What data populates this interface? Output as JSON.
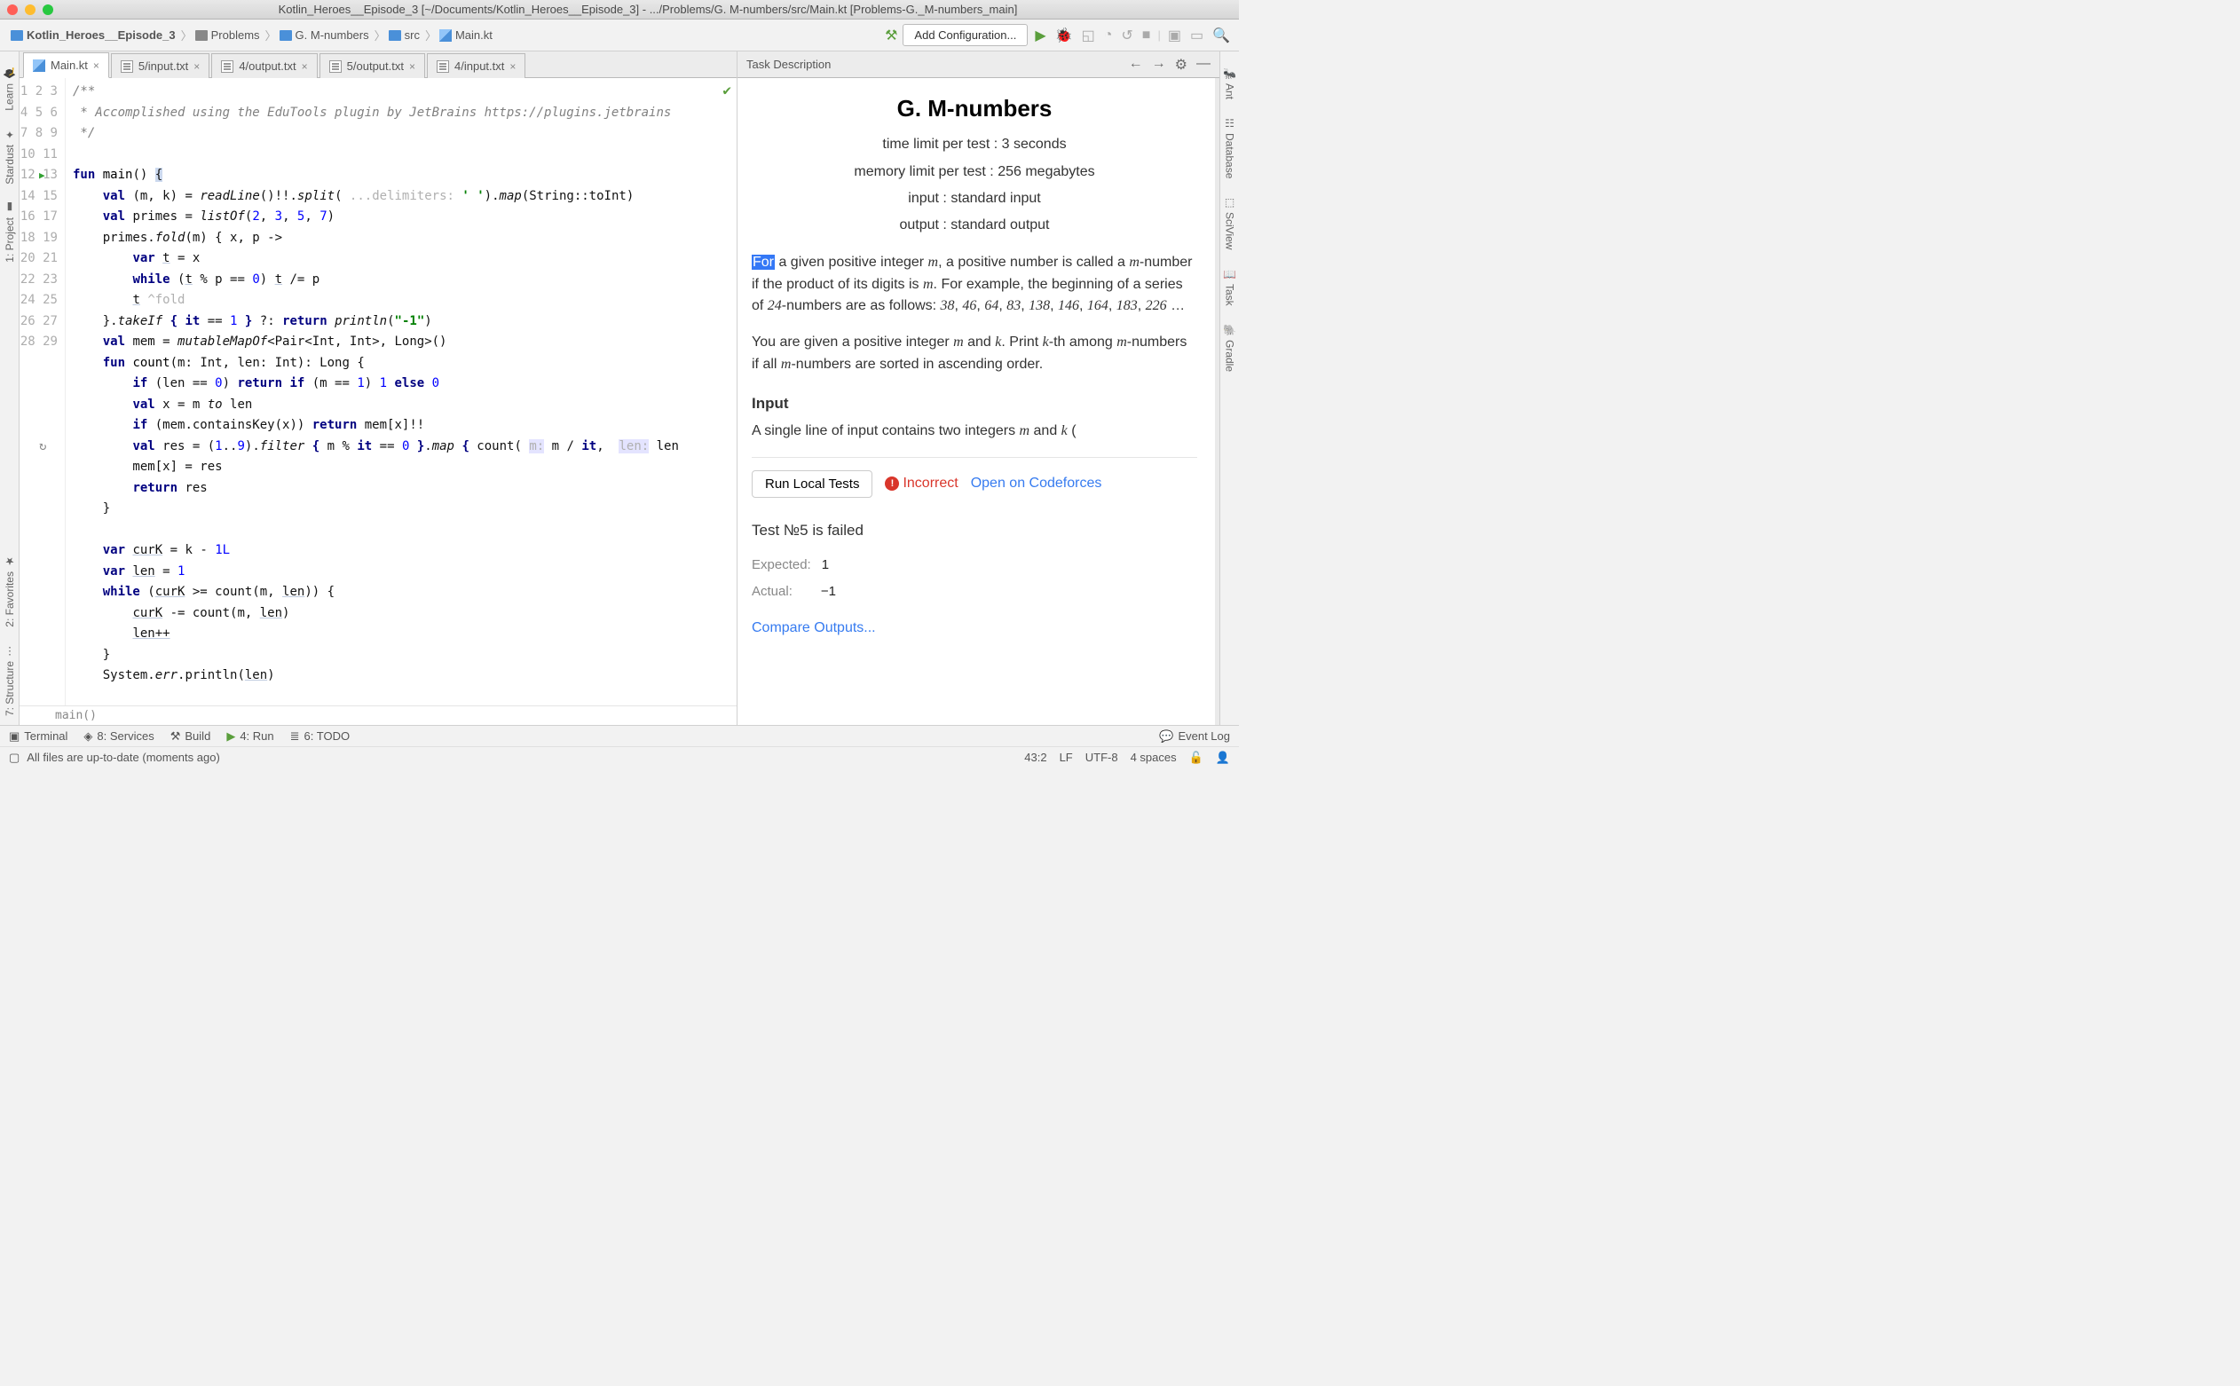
{
  "title": "Kotlin_Heroes__Episode_3 [~/Documents/Kotlin_Heroes__Episode_3] - .../Problems/G. M-numbers/src/Main.kt [Problems-G._M-numbers_main]",
  "breadcrumb": {
    "project": "Kotlin_Heroes__Episode_3",
    "problems": "Problems",
    "problem": "G. M-numbers",
    "src": "src",
    "file": "Main.kt"
  },
  "addConfig": "Add Configuration...",
  "vbar": {
    "learn": "Learn",
    "stardust": "Stardust",
    "project": "1: Project",
    "favorites": "2: Favorites",
    "structure": "7: Structure"
  },
  "rvbar": {
    "ant": "Ant",
    "database": "Database",
    "sciview": "SciView",
    "task": "Task",
    "gradle": "Gradle"
  },
  "tabs": {
    "t0": "Main.kt",
    "t1": "5/input.txt",
    "t2": "4/output.txt",
    "t3": "5/output.txt",
    "t4": "4/input.txt"
  },
  "code": {
    "l1": "/**",
    "l2": " * Accomplished using the EduTools plugin by JetBrains https://plugins.jetbrains",
    "l3": " */",
    "hintDelim": "...delimiters:",
    "hintM": "m:",
    "hintLen": "len:",
    "context": "main()"
  },
  "side": {
    "title": "Task Description",
    "problem": "G. M-numbers",
    "time": "time limit per test : 3 seconds",
    "memory": "memory limit per test : 256 megabytes",
    "input": "input : standard input",
    "output": "output : standard output",
    "inputHdr": "Input",
    "runLocal": "Run Local Tests",
    "incorrect": "Incorrect",
    "openCF": "Open on Codeforces",
    "testFail": "Test №5 is failed",
    "expectedLbl": "Expected:",
    "expectedVal": "1",
    "actualLbl": "Actual:",
    "actualVal": "−1",
    "compare": "Compare Outputs..."
  },
  "bottom": {
    "terminal": "Terminal",
    "services": "8: Services",
    "build": "Build",
    "run": "4: Run",
    "todo": "6: TODO",
    "eventLog": "Event Log"
  },
  "status": {
    "msg": "All files are up-to-date (moments ago)",
    "pos": "43:2",
    "eol": "LF",
    "enc": "UTF-8",
    "indent": "4 spaces"
  }
}
